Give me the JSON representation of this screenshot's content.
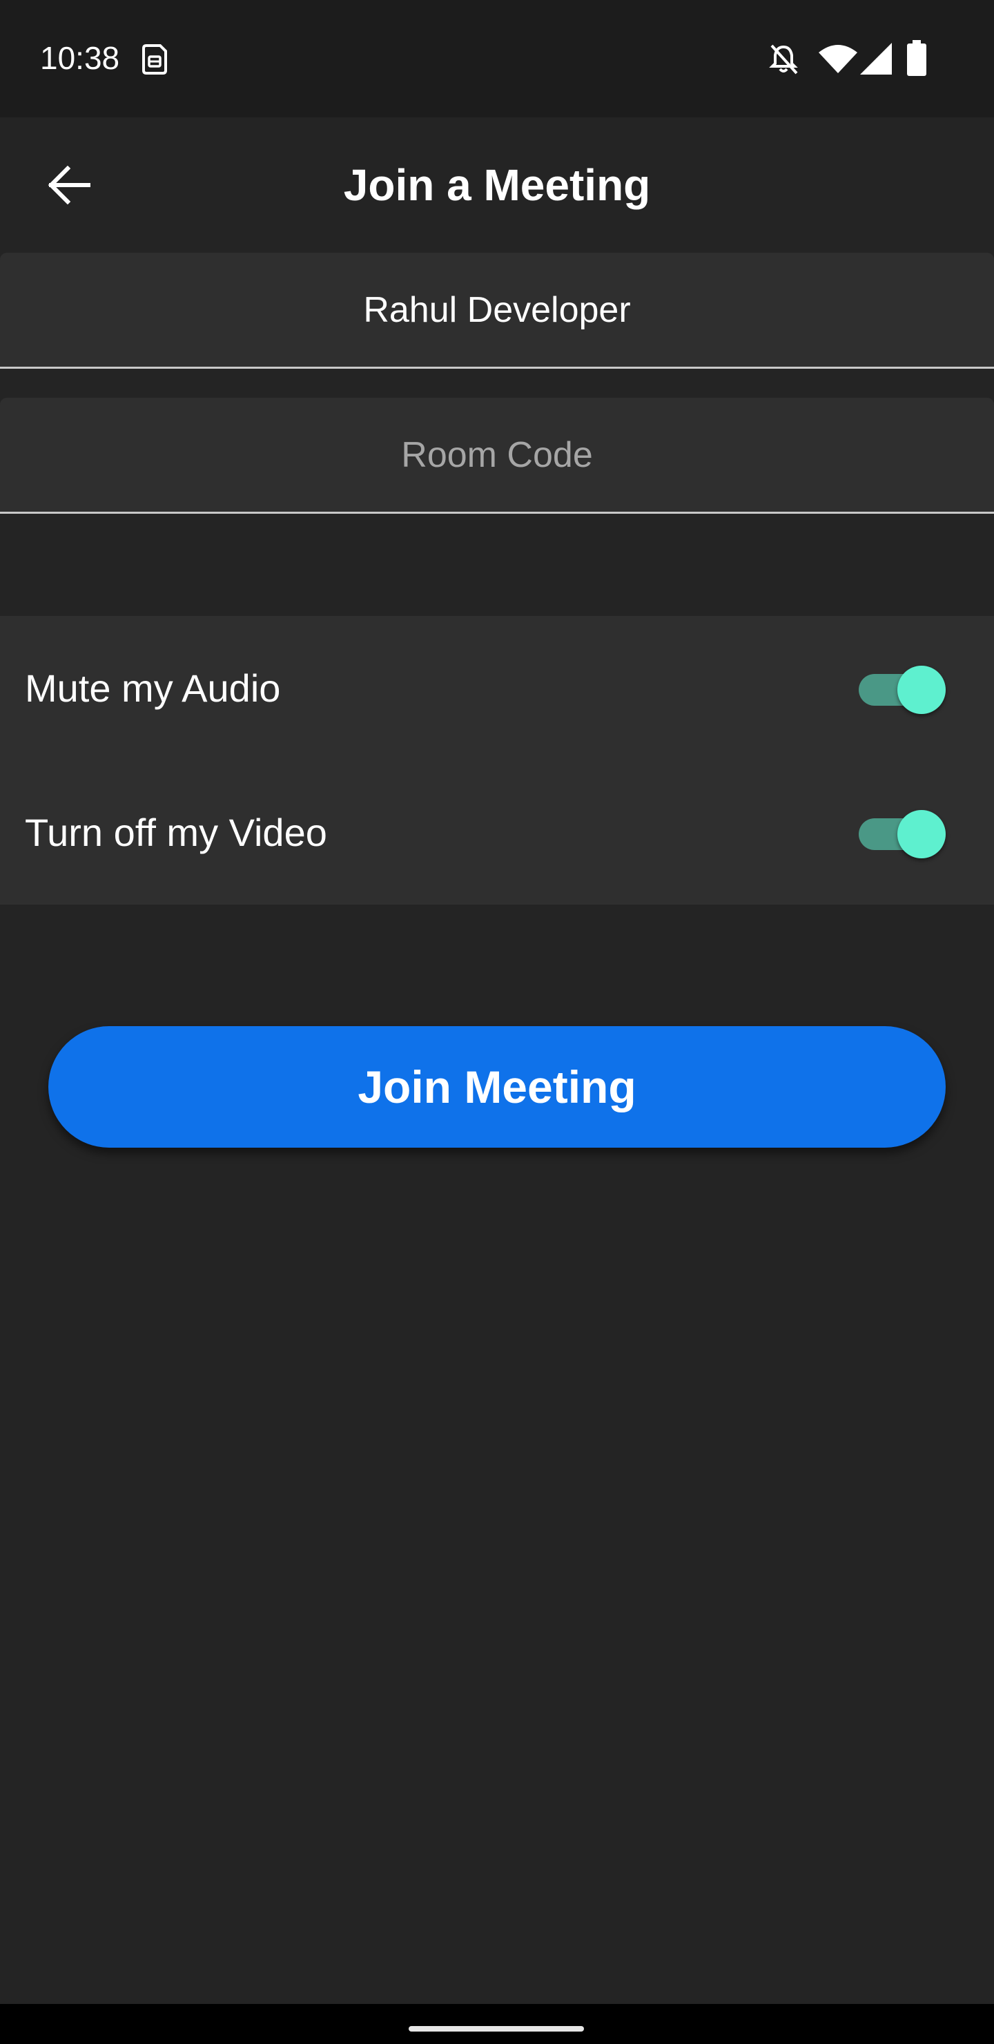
{
  "status_bar": {
    "time": "10:38",
    "icons": [
      "sim-card-icon",
      "notifications-off-icon",
      "wifi-icon",
      "cellular-signal-icon",
      "battery-icon"
    ]
  },
  "app_bar": {
    "title": "Join a Meeting",
    "back_icon": "arrow-left-icon"
  },
  "form": {
    "name_value": "Rahul Developer",
    "room_code_value": "",
    "room_code_placeholder": "Room Code"
  },
  "toggles": [
    {
      "label": "Mute my Audio",
      "on": true
    },
    {
      "label": "Turn off my Video",
      "on": true
    }
  ],
  "join_button_label": "Join Meeting",
  "colors": {
    "background": "#242424",
    "status_bar": "#1c1c1c",
    "panel": "#2f2f2f",
    "switch_track": "#4a9886",
    "switch_thumb": "#5ef0cf",
    "primary_button": "#0f72ea"
  }
}
